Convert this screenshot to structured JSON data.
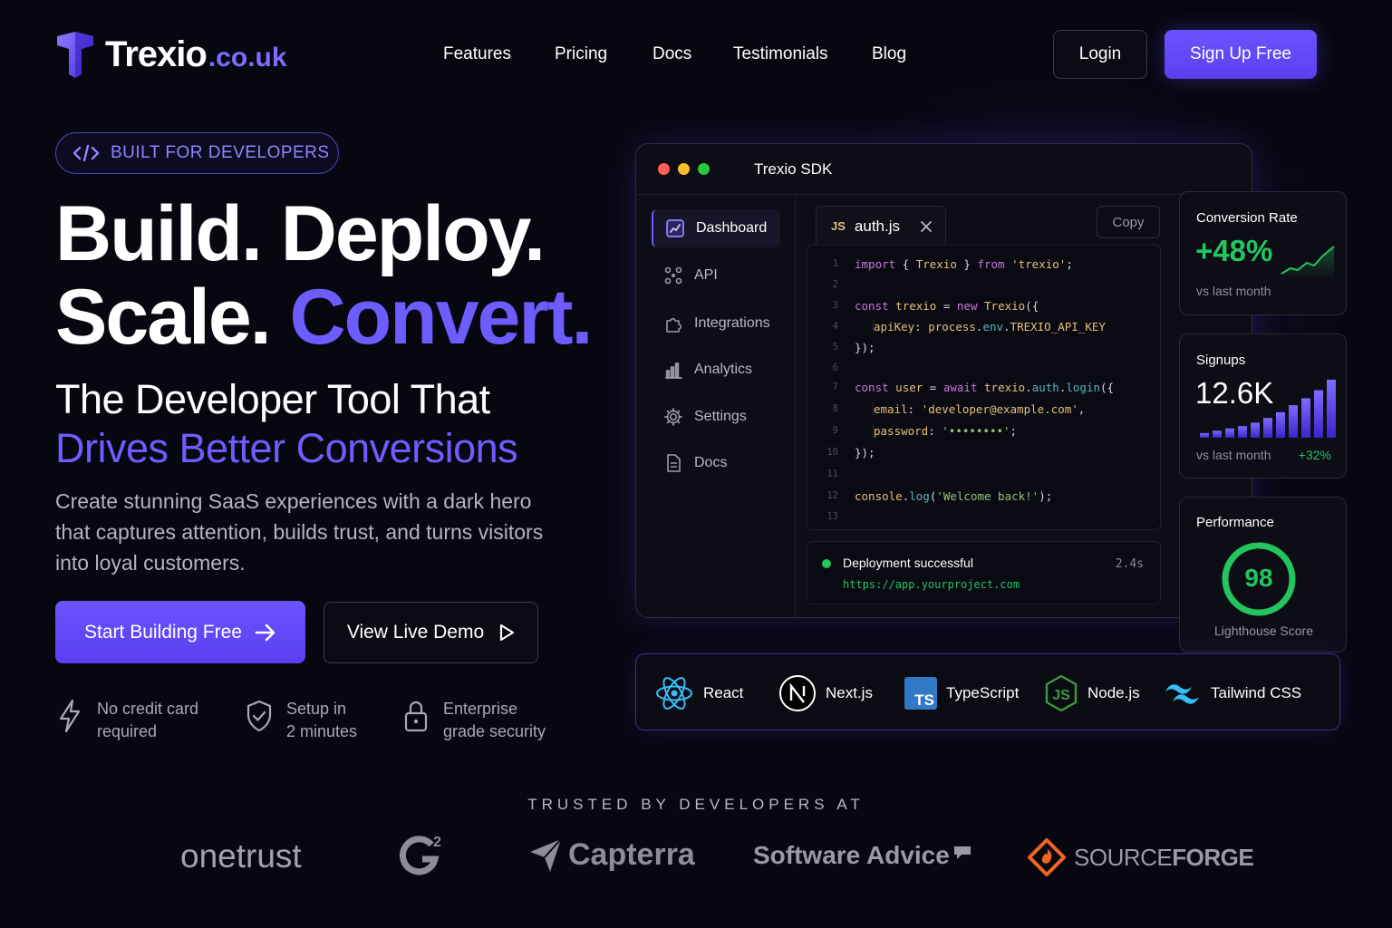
{
  "brand": {
    "name": "Trexio",
    "tld": ".co.uk"
  },
  "nav": {
    "items": [
      "Features",
      "Pricing",
      "Docs",
      "Testimonials",
      "Blog"
    ],
    "login": "Login",
    "signup": "Sign Up Free"
  },
  "hero": {
    "badge": "BUILT FOR DEVELOPERS",
    "title_line1": "Build. Deploy.",
    "title_line2_a": "Scale.",
    "title_line2_b": "Convert.",
    "subtitle_line1": "The Developer Tool That",
    "subtitle_line2": "Drives Better Conversions",
    "lead": "Create stunning SaaS experiences with a dark hero that captures attention, builds trust, and turns visitors into loyal customers.",
    "cta_primary": "Start Building Free",
    "cta_secondary": "View Live Demo",
    "features": [
      {
        "line1": "No credit card",
        "line2": "required",
        "icon": "lightning-icon"
      },
      {
        "line1": "Setup in",
        "line2": "2 minutes",
        "icon": "shield-check-icon"
      },
      {
        "line1": "Enterprise",
        "line2": "grade security",
        "icon": "lock-icon"
      }
    ]
  },
  "sdk": {
    "title": "Trexio SDK",
    "sidebar": [
      "Dashboard",
      "API",
      "Integrations",
      "Analytics",
      "Settings",
      "Docs"
    ],
    "tab": {
      "lang": "JS",
      "file": "auth.js"
    },
    "copy": "Copy",
    "line_numbers": [
      "1",
      "2",
      "3",
      "4",
      "5",
      "6",
      "7",
      "8",
      "9",
      "10",
      "11",
      "12",
      "13"
    ],
    "code": {
      "l1": [
        "import",
        " { ",
        "Trexio",
        " } ",
        "from",
        " ",
        "'trexio'",
        ";"
      ],
      "l3": [
        "const",
        " ",
        "trexio",
        " = ",
        "new",
        " ",
        "Trexio",
        "({"
      ],
      "l4": [
        "apiKey",
        ": ",
        "process",
        ".",
        "env",
        ".",
        "TREXIO_API_KEY"
      ],
      "l5": "});",
      "l7": [
        "const",
        " ",
        "user",
        " = ",
        "await",
        " ",
        "trexio",
        ".",
        "auth",
        ".",
        "login",
        "({"
      ],
      "l8": [
        "email",
        ": ",
        "'developer@example.com'",
        ","
      ],
      "l9": [
        "password",
        ": ",
        "'••••••••'",
        ";"
      ],
      "l10": "});",
      "l12": [
        "console",
        ".",
        "log",
        "(",
        "'Welcome back!'",
        ");"
      ]
    },
    "deploy": {
      "status": "Deployment successful",
      "url": "https://app.yourproject.com",
      "time": "2.4s",
      "status_color": "#22c55e"
    }
  },
  "stats": {
    "conversion": {
      "title": "Conversion Rate",
      "value": "+48%",
      "note": "vs last month",
      "color": "#22c55e"
    },
    "signups": {
      "title": "Signups",
      "value": "12.6K",
      "note": "vs last month",
      "change": "+32%",
      "bars": [
        0.08,
        0.12,
        0.16,
        0.2,
        0.26,
        0.34,
        0.44,
        0.56,
        0.68,
        0.82,
        1.0
      ]
    },
    "performance": {
      "title": "Performance",
      "score": "98",
      "label": "Lighthouse Score",
      "fraction": 0.98
    }
  },
  "tech": [
    {
      "name": "React",
      "icon": "react-icon"
    },
    {
      "name": "Next.js",
      "icon": "nextjs-icon"
    },
    {
      "name": "TypeScript",
      "icon": "typescript-icon"
    },
    {
      "name": "Node.js",
      "icon": "nodejs-icon"
    },
    {
      "name": "Tailwind CSS",
      "icon": "tailwind-icon"
    }
  ],
  "trusted": {
    "label": "TRUSTED BY DEVELOPERS AT",
    "logos": [
      "onetrust",
      "G2",
      "Capterra",
      "Software Advice",
      "SOURCEFORGE"
    ],
    "g2_sup": "2",
    "sourceforge_a": "SOURCE",
    "sourceforge_b": "FORGE"
  },
  "colors": {
    "accent": "#6d5cff",
    "success": "#22c55e",
    "background": "#07070f"
  }
}
